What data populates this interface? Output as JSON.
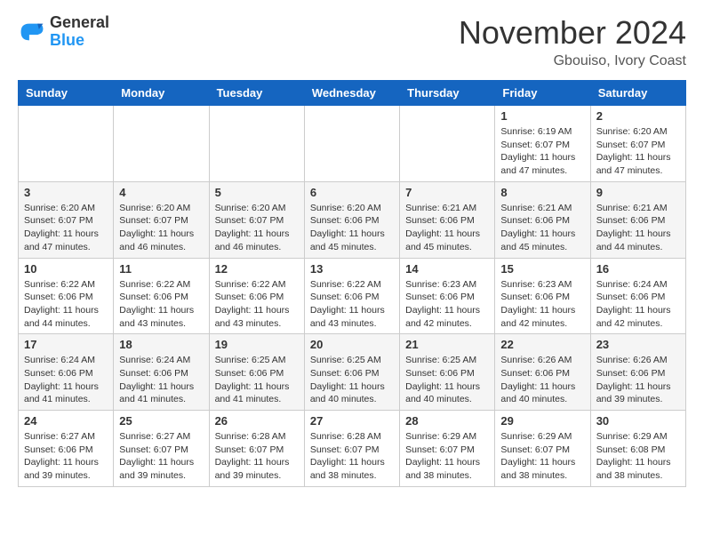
{
  "header": {
    "logo_line1": "General",
    "logo_line2": "Blue",
    "month_title": "November 2024",
    "location": "Gbouiso, Ivory Coast"
  },
  "days_of_week": [
    "Sunday",
    "Monday",
    "Tuesday",
    "Wednesday",
    "Thursday",
    "Friday",
    "Saturday"
  ],
  "weeks": [
    [
      {
        "day": "",
        "info": ""
      },
      {
        "day": "",
        "info": ""
      },
      {
        "day": "",
        "info": ""
      },
      {
        "day": "",
        "info": ""
      },
      {
        "day": "",
        "info": ""
      },
      {
        "day": "1",
        "info": "Sunrise: 6:19 AM\nSunset: 6:07 PM\nDaylight: 11 hours and 47 minutes."
      },
      {
        "day": "2",
        "info": "Sunrise: 6:20 AM\nSunset: 6:07 PM\nDaylight: 11 hours and 47 minutes."
      }
    ],
    [
      {
        "day": "3",
        "info": "Sunrise: 6:20 AM\nSunset: 6:07 PM\nDaylight: 11 hours and 47 minutes."
      },
      {
        "day": "4",
        "info": "Sunrise: 6:20 AM\nSunset: 6:07 PM\nDaylight: 11 hours and 46 minutes."
      },
      {
        "day": "5",
        "info": "Sunrise: 6:20 AM\nSunset: 6:07 PM\nDaylight: 11 hours and 46 minutes."
      },
      {
        "day": "6",
        "info": "Sunrise: 6:20 AM\nSunset: 6:06 PM\nDaylight: 11 hours and 45 minutes."
      },
      {
        "day": "7",
        "info": "Sunrise: 6:21 AM\nSunset: 6:06 PM\nDaylight: 11 hours and 45 minutes."
      },
      {
        "day": "8",
        "info": "Sunrise: 6:21 AM\nSunset: 6:06 PM\nDaylight: 11 hours and 45 minutes."
      },
      {
        "day": "9",
        "info": "Sunrise: 6:21 AM\nSunset: 6:06 PM\nDaylight: 11 hours and 44 minutes."
      }
    ],
    [
      {
        "day": "10",
        "info": "Sunrise: 6:22 AM\nSunset: 6:06 PM\nDaylight: 11 hours and 44 minutes."
      },
      {
        "day": "11",
        "info": "Sunrise: 6:22 AM\nSunset: 6:06 PM\nDaylight: 11 hours and 43 minutes."
      },
      {
        "day": "12",
        "info": "Sunrise: 6:22 AM\nSunset: 6:06 PM\nDaylight: 11 hours and 43 minutes."
      },
      {
        "day": "13",
        "info": "Sunrise: 6:22 AM\nSunset: 6:06 PM\nDaylight: 11 hours and 43 minutes."
      },
      {
        "day": "14",
        "info": "Sunrise: 6:23 AM\nSunset: 6:06 PM\nDaylight: 11 hours and 42 minutes."
      },
      {
        "day": "15",
        "info": "Sunrise: 6:23 AM\nSunset: 6:06 PM\nDaylight: 11 hours and 42 minutes."
      },
      {
        "day": "16",
        "info": "Sunrise: 6:24 AM\nSunset: 6:06 PM\nDaylight: 11 hours and 42 minutes."
      }
    ],
    [
      {
        "day": "17",
        "info": "Sunrise: 6:24 AM\nSunset: 6:06 PM\nDaylight: 11 hours and 41 minutes."
      },
      {
        "day": "18",
        "info": "Sunrise: 6:24 AM\nSunset: 6:06 PM\nDaylight: 11 hours and 41 minutes."
      },
      {
        "day": "19",
        "info": "Sunrise: 6:25 AM\nSunset: 6:06 PM\nDaylight: 11 hours and 41 minutes."
      },
      {
        "day": "20",
        "info": "Sunrise: 6:25 AM\nSunset: 6:06 PM\nDaylight: 11 hours and 40 minutes."
      },
      {
        "day": "21",
        "info": "Sunrise: 6:25 AM\nSunset: 6:06 PM\nDaylight: 11 hours and 40 minutes."
      },
      {
        "day": "22",
        "info": "Sunrise: 6:26 AM\nSunset: 6:06 PM\nDaylight: 11 hours and 40 minutes."
      },
      {
        "day": "23",
        "info": "Sunrise: 6:26 AM\nSunset: 6:06 PM\nDaylight: 11 hours and 39 minutes."
      }
    ],
    [
      {
        "day": "24",
        "info": "Sunrise: 6:27 AM\nSunset: 6:06 PM\nDaylight: 11 hours and 39 minutes."
      },
      {
        "day": "25",
        "info": "Sunrise: 6:27 AM\nSunset: 6:07 PM\nDaylight: 11 hours and 39 minutes."
      },
      {
        "day": "26",
        "info": "Sunrise: 6:28 AM\nSunset: 6:07 PM\nDaylight: 11 hours and 39 minutes."
      },
      {
        "day": "27",
        "info": "Sunrise: 6:28 AM\nSunset: 6:07 PM\nDaylight: 11 hours and 38 minutes."
      },
      {
        "day": "28",
        "info": "Sunrise: 6:29 AM\nSunset: 6:07 PM\nDaylight: 11 hours and 38 minutes."
      },
      {
        "day": "29",
        "info": "Sunrise: 6:29 AM\nSunset: 6:07 PM\nDaylight: 11 hours and 38 minutes."
      },
      {
        "day": "30",
        "info": "Sunrise: 6:29 AM\nSunset: 6:08 PM\nDaylight: 11 hours and 38 minutes."
      }
    ]
  ]
}
